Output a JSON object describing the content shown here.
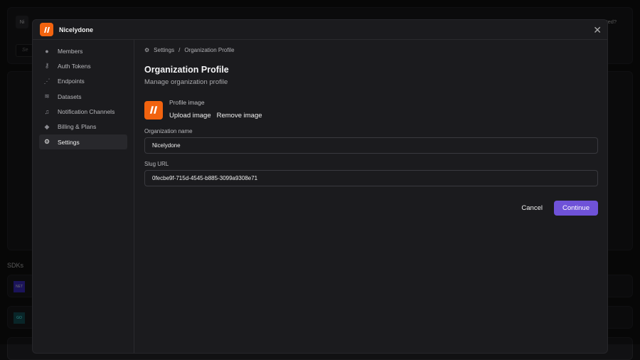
{
  "background": {
    "avatar_initials": "Ni",
    "search_partial": "Se",
    "getting_started_partial": "rted?",
    "sdks_label": "SDKs",
    "sdk_badges": [
      "NET",
      "GO"
    ]
  },
  "modal": {
    "org_name": "Nicelydone",
    "sidebar": {
      "items": [
        {
          "label": "Members",
          "icon": "user-icon"
        },
        {
          "label": "Auth Tokens",
          "icon": "key-icon"
        },
        {
          "label": "Endpoints",
          "icon": "endpoints-icon"
        },
        {
          "label": "Datasets",
          "icon": "layers-icon"
        },
        {
          "label": "Notification Channels",
          "icon": "bell-icon"
        },
        {
          "label": "Billing & Plans",
          "icon": "diamond-icon"
        },
        {
          "label": "Settings",
          "icon": "gear-icon",
          "active": true
        }
      ]
    },
    "breadcrumb": {
      "root": "Settings",
      "sep": "/",
      "current": "Organization Profile"
    },
    "title": "Organization Profile",
    "subtitle": "Manage organization profile",
    "profile_image": {
      "label": "Profile image",
      "upload": "Upload image",
      "remove": "Remove image"
    },
    "fields": {
      "org_name_label": "Organization name",
      "org_name_value": "Nicelydone",
      "slug_label": "Slug URL",
      "slug_value": "0fecbe9f-715d-4545-b885-3099a9308e71"
    },
    "actions": {
      "cancel": "Cancel",
      "continue": "Continue"
    },
    "colors": {
      "accent": "#6f52d8",
      "logo": "#f2630f"
    }
  }
}
